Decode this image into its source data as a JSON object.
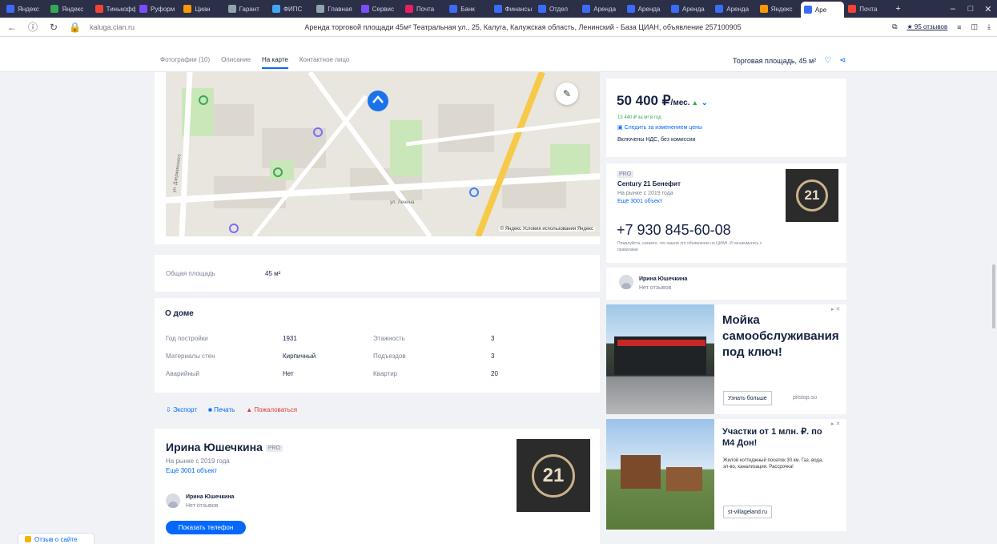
{
  "browser": {
    "tabs": [
      {
        "label": "Яндекс",
        "color": "#3b6cf7"
      },
      {
        "label": "Яндекс",
        "color": "#34a853"
      },
      {
        "label": "Тинькофф",
        "color": "#f44336"
      },
      {
        "label": "Руформ",
        "color": "#7c4dff"
      },
      {
        "label": "Циан",
        "color": "#ff9800"
      },
      {
        "label": "Гарант",
        "color": "#90a4ae"
      },
      {
        "label": "ФИПС",
        "color": "#42a5f5"
      },
      {
        "label": "Главная",
        "color": "#90a4ae"
      },
      {
        "label": "Сервис",
        "color": "#7c4dff"
      },
      {
        "label": "Почта",
        "color": "#e91e63"
      },
      {
        "label": "Банк",
        "color": "#3b6cf7"
      },
      {
        "label": "Финансы",
        "color": "#3b6cf7"
      },
      {
        "label": "Отдел",
        "color": "#3b6cf7"
      },
      {
        "label": "Аренда",
        "color": "#3b6cf7"
      },
      {
        "label": "Аренда",
        "color": "#3b6cf7"
      },
      {
        "label": "Аренда",
        "color": "#3b6cf7"
      },
      {
        "label": "Аренда",
        "color": "#3b6cf7"
      },
      {
        "label": "Яндекс",
        "color": "#ff9800"
      },
      {
        "label": "Аре",
        "color": "#3b6cf7",
        "active": true
      },
      {
        "label": "Почта",
        "color": "#f44336"
      }
    ],
    "url": "kaluga.cian.ru",
    "page_title": "Аренда торговой площади 45м² Театральная ул., 25, Калуга, Калужская область, Ленинский - База ЦИАН, объявление 257100905",
    "reviews_label": "★ 95 отзывов"
  },
  "subnav": {
    "links": [
      "Фотографии (10)",
      "Описание",
      "На карте",
      "Контактное лицо"
    ],
    "active_index": 2,
    "area_label": "Торговая площадь, 45 м²"
  },
  "map": {
    "street_1": "ул. Дзержинского",
    "street_2": "ул. Ленина",
    "credits": "© Яндекс  Условия использования  Яндекс"
  },
  "details": {
    "area_label": "Общая площадь",
    "area_value": "45 м²"
  },
  "house": {
    "title": "О доме",
    "rows": [
      {
        "l1": "Год постройки",
        "v1": "1931",
        "l2": "Этажность",
        "v2": "3"
      },
      {
        "l1": "Материалы стен",
        "v1": "Кирпичный",
        "l2": "Подъездов",
        "v2": "3"
      },
      {
        "l1": "Аварийный",
        "v1": "Нет",
        "l2": "Квартир",
        "v2": "20"
      }
    ]
  },
  "actions": {
    "export": "Экспорт",
    "print": "Печать",
    "complain": "Пожаловаться"
  },
  "agent": {
    "name": "Ирина Юшечкина",
    "badge": "PRO",
    "since": "На рынке с 2019 года",
    "more": "Ещё 3001 объект",
    "sub_name": "Ирина Юшечкина",
    "sub_reviews": "Нет отзывов",
    "phone_button": "Показать телефон",
    "logo_text": "21"
  },
  "sidebar": {
    "price": "50 400 ₽",
    "per": "/мес.",
    "per_m2": "13 440 ₽ за м² в год",
    "subscribe": "Следить за изменением цены",
    "vat": "Включены НДС, без комиссии",
    "agency_badge": "PRO",
    "agency_name": "Century 21 Бенефит",
    "agency_since": "На рынке с 2019 года",
    "agency_more": "Ещё 3001 объект",
    "phone": "+7 930 845-60-08",
    "phone_note": "Пожалуйста, скажите, что нашли это объявление на ЦИАН. И ознакомьтесь с правилами",
    "contact_name": "Ирина Юшечкина",
    "contact_reviews": "Нет отзывов"
  },
  "ads": {
    "ad1_title": "Мойка самообслуживания под ключ!",
    "ad1_button": "Узнать больше",
    "ad1_domain": "pitstop.su",
    "ad2_title": "Участки от 1 млн. ₽. по М4 Дон!",
    "ad2_text": "Жилой коттеджный поселок 30 км. Газ, вода, эл-во, канализация. Рассрочка!",
    "ad2_button": "st-villageland.ru"
  },
  "feedback_label": "Отзыв о сайте"
}
